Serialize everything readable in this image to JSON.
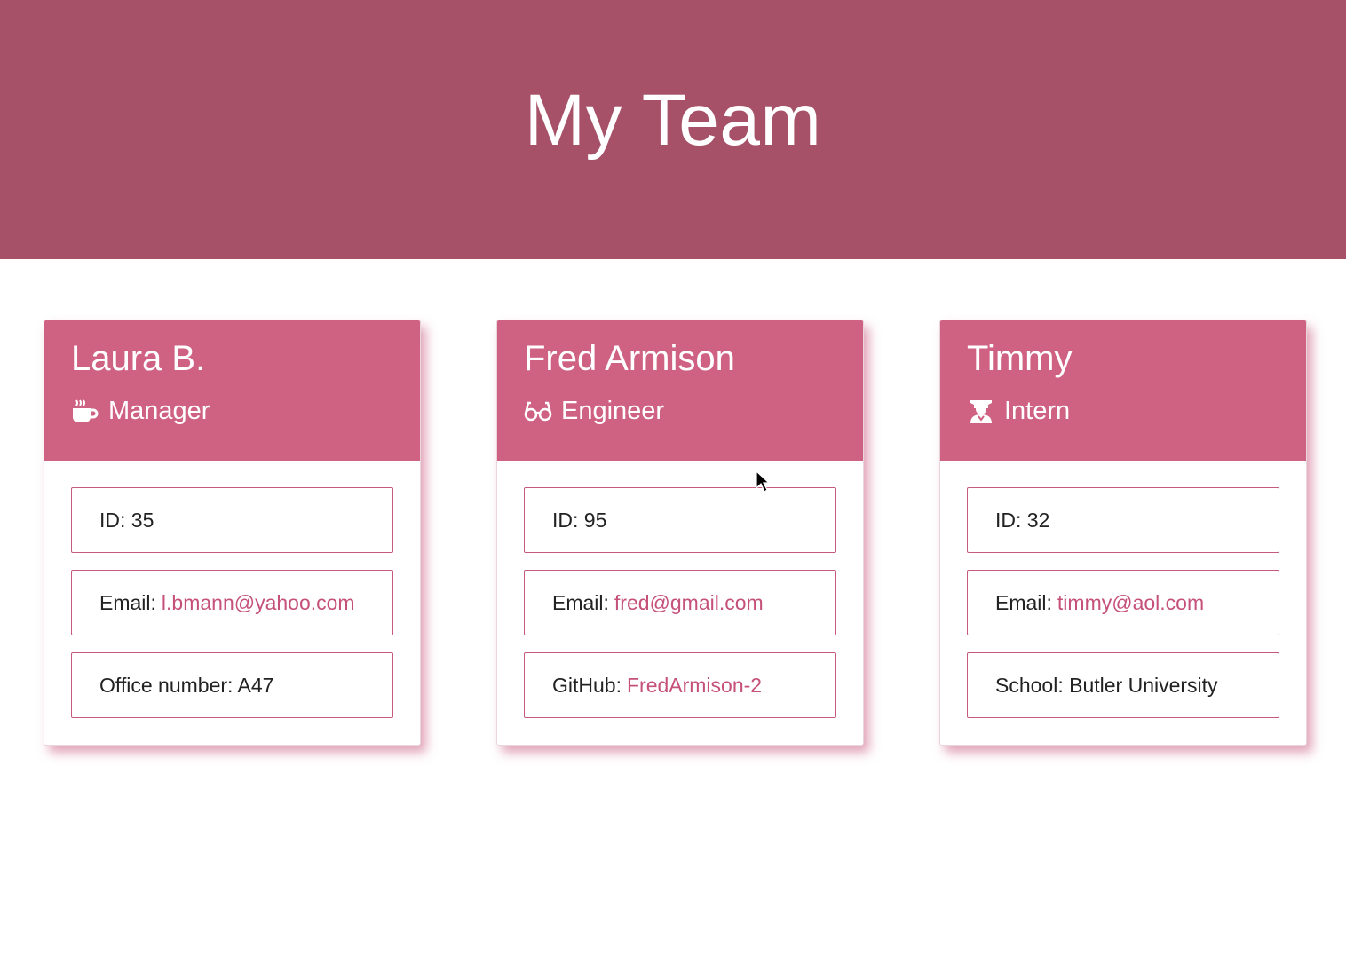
{
  "header": {
    "title": "My Team"
  },
  "colors": {
    "banner": "#a65168",
    "card_header": "#cf6283",
    "accent_link": "#c5507a",
    "row_border": "#c65a7e"
  },
  "team": [
    {
      "name": "Laura B.",
      "role": "Manager",
      "role_icon": "coffee-mug-icon",
      "id_label": "ID: 35",
      "email_label": "Email:",
      "email": "l.bmann@yahoo.com",
      "extra_label": "Office number: A47",
      "extra_link": ""
    },
    {
      "name": "Fred Armison",
      "role": "Engineer",
      "role_icon": "glasses-icon",
      "id_label": "ID: 95",
      "email_label": "Email:",
      "email": "fred@gmail.com",
      "extra_label": "GitHub:",
      "extra_link": "FredArmison-2"
    },
    {
      "name": "Timmy",
      "role": "Intern",
      "role_icon": "graduate-icon",
      "id_label": "ID: 32",
      "email_label": "Email:",
      "email": "timmy@aol.com",
      "extra_label": "School: Butler University",
      "extra_link": ""
    }
  ]
}
